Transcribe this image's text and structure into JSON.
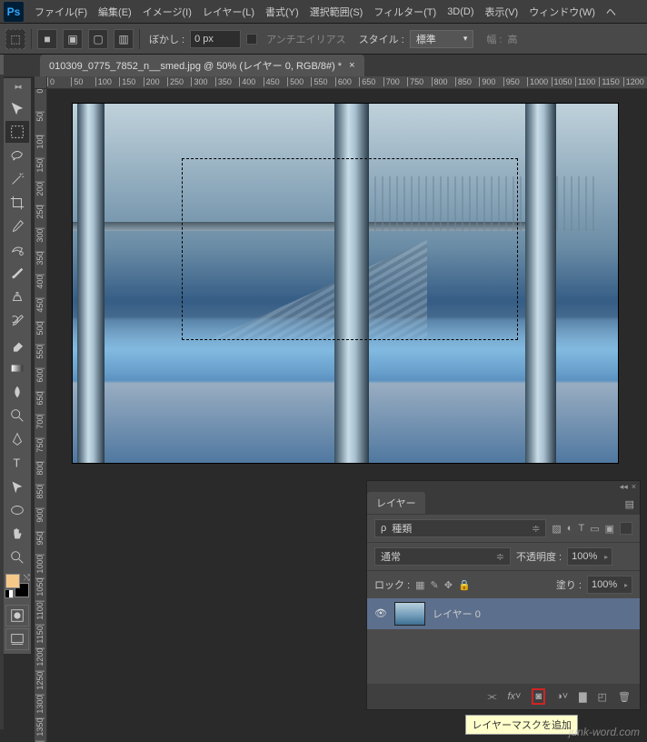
{
  "app": {
    "logo": "Ps"
  },
  "menu": {
    "file": "ファイル(F)",
    "edit": "編集(E)",
    "image": "イメージ(I)",
    "layer": "レイヤー(L)",
    "type": "書式(Y)",
    "select": "選択範囲(S)",
    "filter": "フィルター(T)",
    "threeD": "3D(D)",
    "view": "表示(V)",
    "window": "ウィンドウ(W)",
    "help": "ヘ"
  },
  "options": {
    "feather_label": "ぼかし :",
    "feather_value": "0 px",
    "antialias": "アンチエイリアス",
    "style_label": "スタイル :",
    "style_value": "標準",
    "width_label": "幅 :",
    "extra_label": "高"
  },
  "document": {
    "tab_title": "010309_0775_7852_n__smed.jpg @ 50% (レイヤー 0, RGB/8#) *",
    "close": "×"
  },
  "rulers": {
    "h": [
      "0",
      "50",
      "100",
      "150",
      "200",
      "250",
      "300",
      "350",
      "400",
      "450",
      "500",
      "550",
      "600",
      "650",
      "700",
      "750",
      "800",
      "850",
      "900",
      "950",
      "1000",
      "1050",
      "1100",
      "1150",
      "1200"
    ],
    "v": [
      "0",
      "50",
      "100",
      "150",
      "200",
      "250",
      "300",
      "350",
      "400",
      "450",
      "500",
      "550",
      "600",
      "650",
      "700",
      "750",
      "800",
      "850",
      "900",
      "950",
      "1000",
      "1050",
      "1100",
      "1150",
      "1200",
      "1250",
      "1300",
      "1350"
    ]
  },
  "tools": {
    "names": [
      "move-tool",
      "marquee-tool",
      "lasso-tool",
      "magic-wand-tool",
      "crop-tool",
      "eyedropper-tool",
      "healing-brush-tool",
      "brush-tool",
      "clone-stamp-tool",
      "history-brush-tool",
      "eraser-tool",
      "gradient-tool",
      "blur-tool",
      "dodge-tool",
      "pen-tool",
      "type-tool",
      "path-selection-tool",
      "rectangle-tool",
      "hand-tool",
      "zoom-tool"
    ],
    "selected_index": 1
  },
  "swatches": {
    "foreground": "#f5c889",
    "background": "#000000"
  },
  "layers_panel": {
    "title": "レイヤー",
    "collapse": "◂◂",
    "close": "×",
    "menu": "▤",
    "kind_label": "種類",
    "search_icon": "ρ",
    "blend_mode": "通常",
    "opacity_label": "不透明度 :",
    "opacity_value": "100%",
    "lock_label": "ロック :",
    "fill_label": "塗り :",
    "fill_value": "100%",
    "filter_icons": {
      "pixel": "▨",
      "adjust": "◐",
      "type": "T",
      "shape": "▭",
      "smart": "▣"
    },
    "lock_icons": {
      "transparent": "▦",
      "pixels": "✎",
      "position": "✥",
      "all": "🔒"
    },
    "layer_name": "レイヤー 0",
    "footer": {
      "link": "⫘",
      "fx": "fx˅",
      "mask": "◙",
      "adjust": "◑˅",
      "group": "▇",
      "new": "◰",
      "trash": "🗑"
    },
    "tooltip": "レイヤーマスクを追加"
  },
  "watermark": "junk-word.com"
}
